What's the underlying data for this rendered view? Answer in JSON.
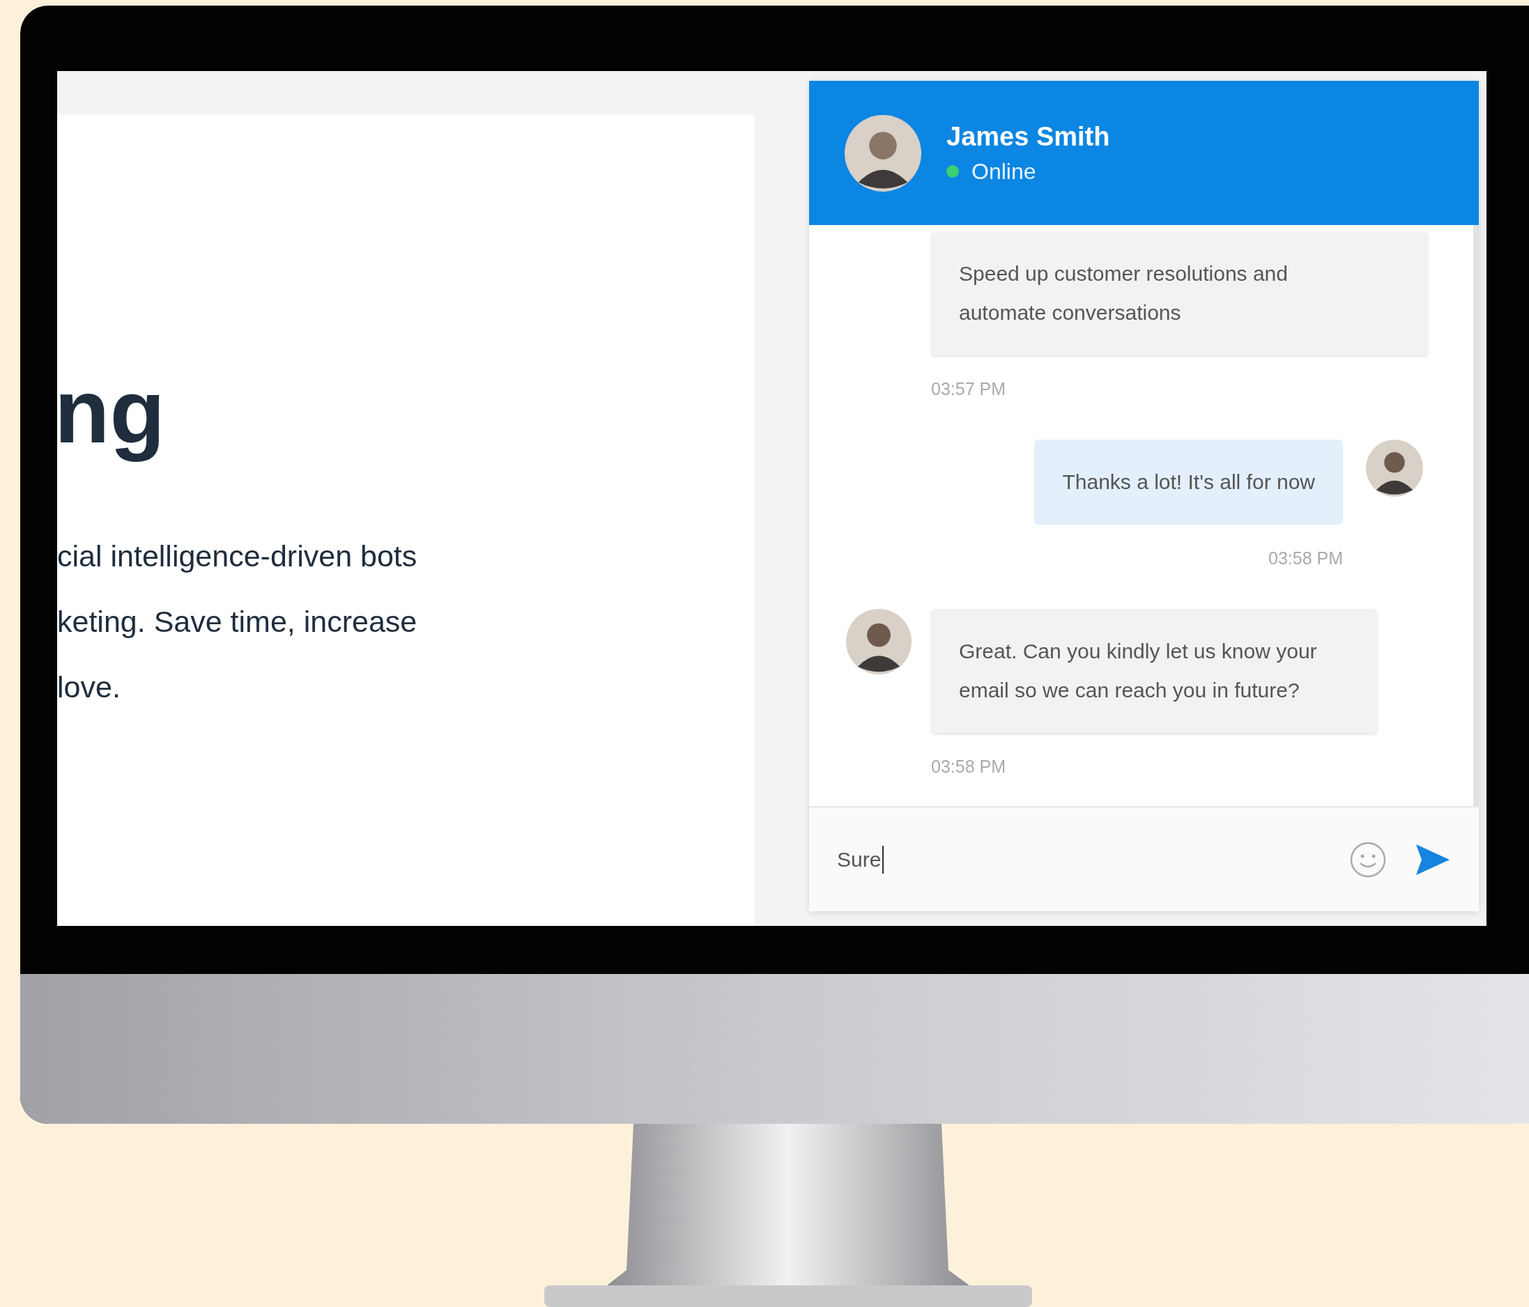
{
  "page": {
    "heading_fragment": "ng",
    "paragraph_lines": [
      "cial intelligence-driven bots",
      "keting. Save time, increase",
      "love."
    ]
  },
  "chat": {
    "contact": {
      "name": "James Smith",
      "status": "Online",
      "online": true
    },
    "messages": [
      {
        "kind": "incoming",
        "avatar": false,
        "text": "Speed up customer resolutions and automate conversations",
        "time": "03:57 PM"
      },
      {
        "kind": "outgoing",
        "avatar": true,
        "text": "Thanks a lot! It's all for now",
        "time": "03:58 PM"
      },
      {
        "kind": "incoming",
        "avatar": true,
        "text": "Great. Can you kindly let us know your email so we can reach you in future?",
        "time": "03:58 PM"
      }
    ],
    "input": {
      "value": "Sure"
    }
  }
}
